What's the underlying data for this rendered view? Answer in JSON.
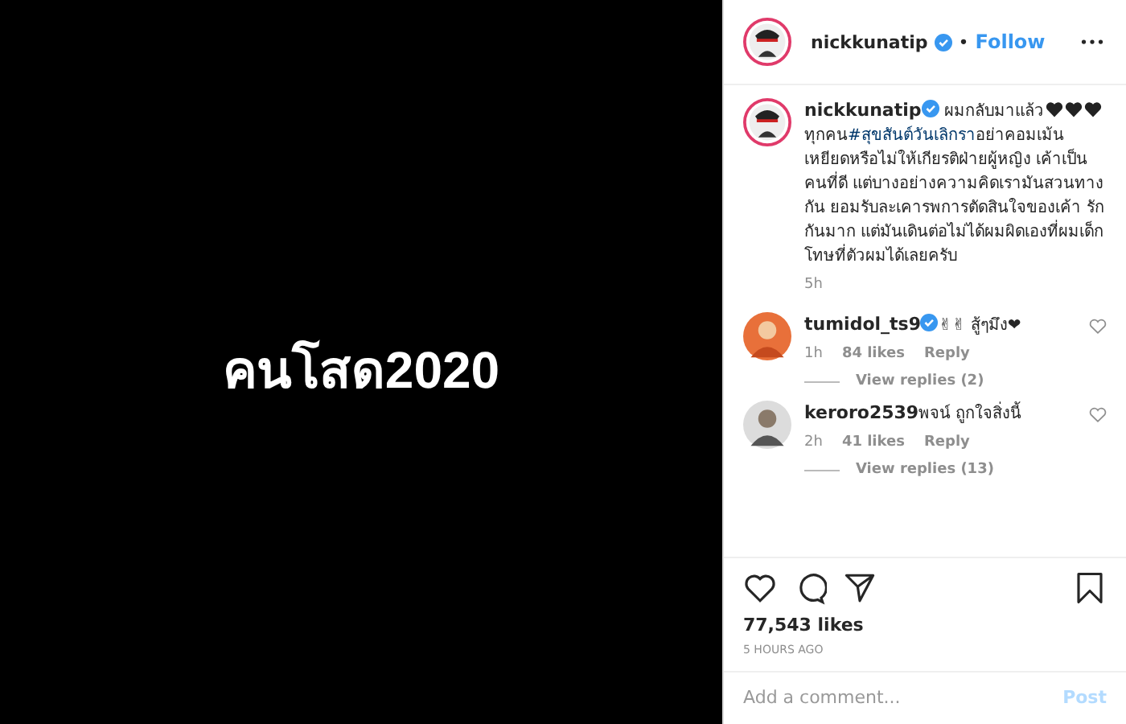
{
  "post_image": {
    "text": "คนโสด2020"
  },
  "header": {
    "username": "nickkunatip",
    "verified": true,
    "follow": "Follow",
    "separator": "•"
  },
  "caption": {
    "username": "nickkunatip",
    "verified": true,
    "lead": "ผมกลับมาแล้ว",
    "segments": [
      {
        "kind": "text",
        "text": "ทุกคน"
      },
      {
        "kind": "hashtag",
        "text": "#สุขสันต์วันเลิกรา"
      },
      {
        "kind": "text",
        "text": "อย่าคอมเม้นเหยียดหรือไม่ให้เกียรติฝ่ายผู้หญิง เค้าเป็นคนที่ดี แต่บางอย่างความคิดเรามันสวนทางกัน ยอมรับละเคารพการตัดสินใจของเค้า รักกันมาก แต่มันเดินต่อไม่ได้ผมผิดเองที่ผมเด็ก โทษที่ตัวผมได้เลยครับ"
      }
    ],
    "time": "5h"
  },
  "comments": [
    {
      "username": "tumidol_ts9",
      "verified": true,
      "text": "✌✌ สู้ๆมึง❤",
      "time": "1h",
      "likes": "84 likes",
      "reply": "Reply",
      "view_replies": "View replies (2)"
    },
    {
      "username": "keroro2539",
      "verified": false,
      "text": "พจน์ ถูกใจสิ่งนี้",
      "time": "2h",
      "likes": "41 likes",
      "reply": "Reply",
      "view_replies": "View replies (13)"
    }
  ],
  "likes": "77,543 likes",
  "time_ago": "5 HOURS AGO",
  "comment_box": {
    "placeholder": "Add a comment...",
    "post": "Post",
    "disabled": true
  }
}
